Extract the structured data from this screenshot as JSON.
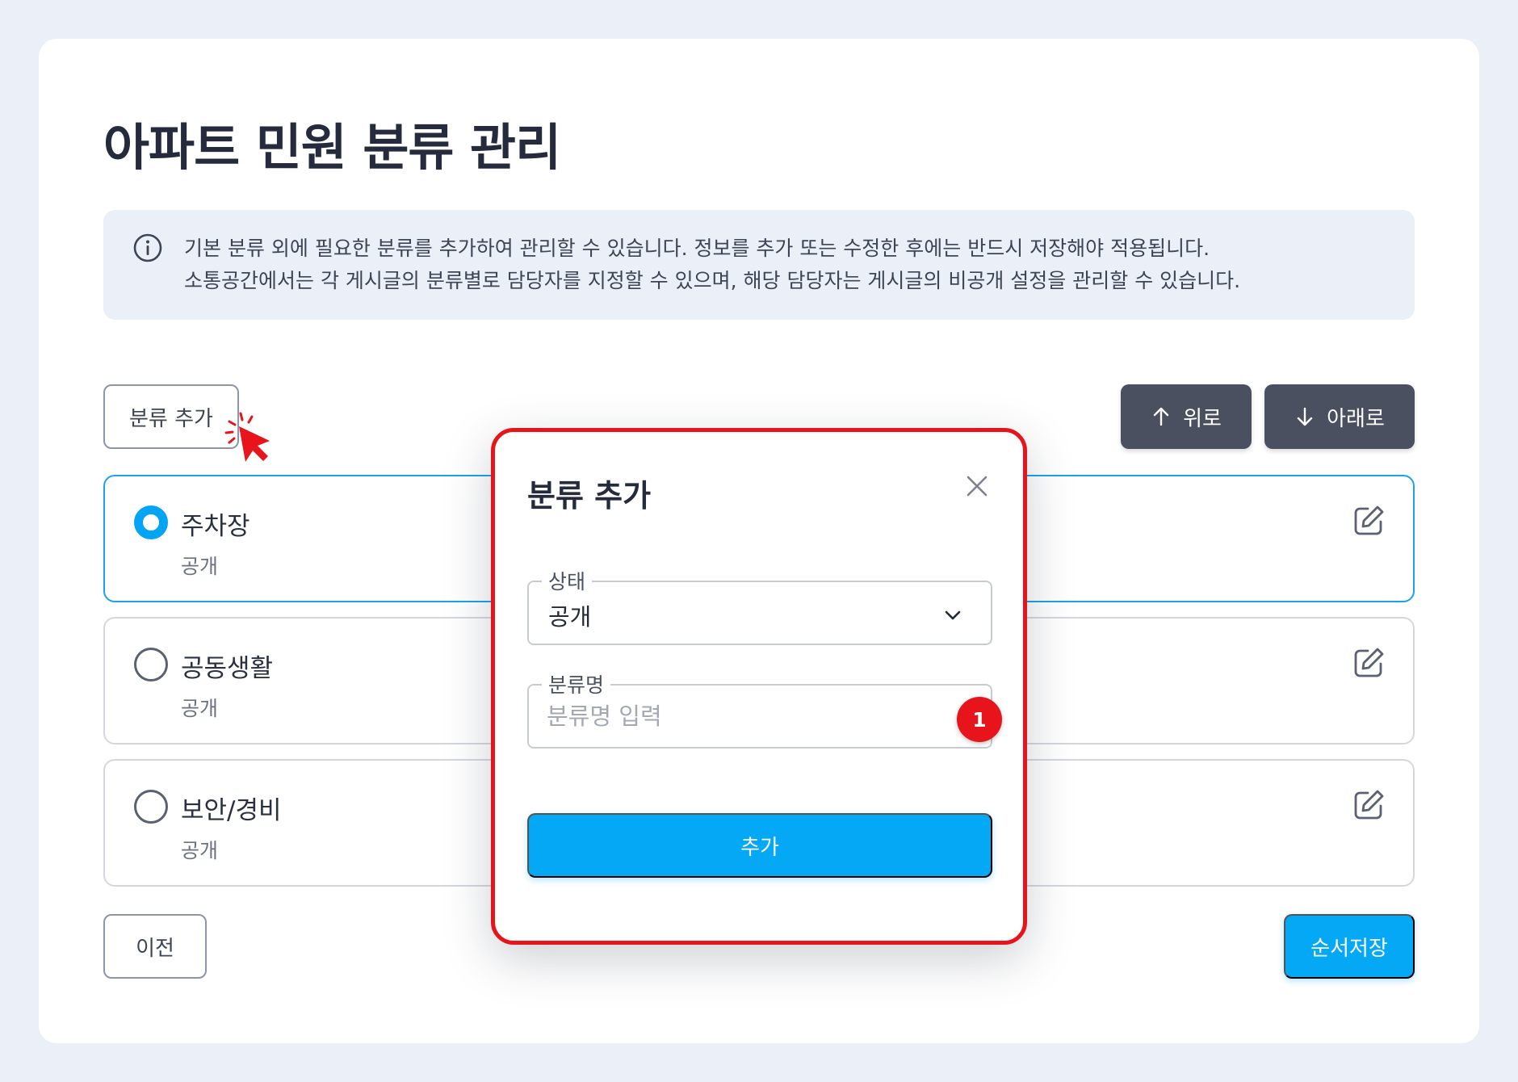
{
  "page": {
    "title": "아파트 민원 분류 관리"
  },
  "info": {
    "icon": "info-icon",
    "line1": "기본 분류 외에 필요한 분류를 추가하여 관리할 수 있습니다. 정보를 추가 또는 수정한 후에는 반드시 저장해야 적용됩니다.",
    "line2": "소통공간에서는 각 게시글의 분류별로 담당자를 지정할 수 있으며, 해당 담당자는 게시글의 비공개 설정을 관리할 수 있습니다."
  },
  "toolbar": {
    "add_category_label": "분류 추가",
    "up_label": "위로",
    "down_label": "아래로"
  },
  "categories": [
    {
      "name": "주차장",
      "status": "공개",
      "selected": true
    },
    {
      "name": "공동생활",
      "status": "공개",
      "selected": false
    },
    {
      "name": "보안/경비",
      "status": "공개",
      "selected": false
    }
  ],
  "footer": {
    "prev_label": "이전",
    "save_order_label": "순서저장"
  },
  "modal": {
    "title": "분류 추가",
    "status_label": "상태",
    "status_value": "공개",
    "name_label": "분류명",
    "name_placeholder": "분류명 입력",
    "name_value": "",
    "step_badge": "1",
    "submit_label": "추가"
  },
  "colors": {
    "accent": "#05a8f5",
    "highlight": "#e8141c",
    "dark_button": "#4a505f",
    "background": "#ebf0f8"
  }
}
